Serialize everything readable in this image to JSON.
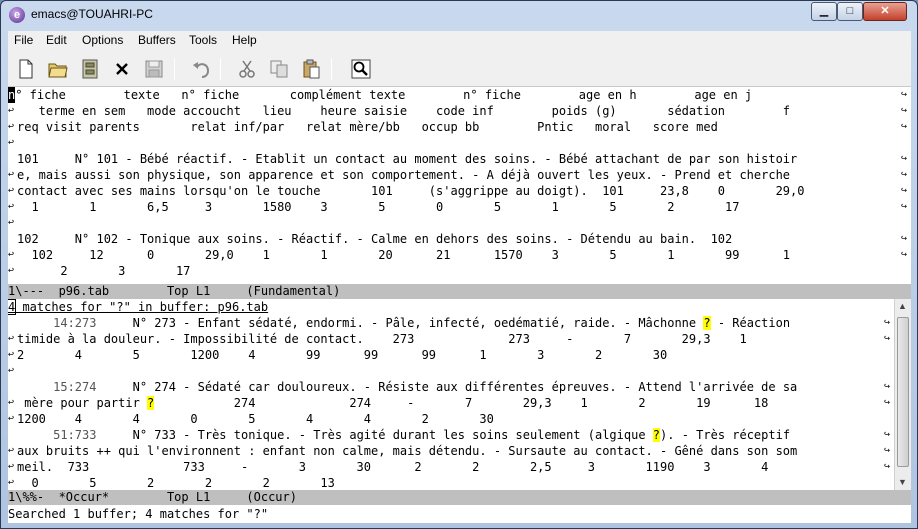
{
  "window": {
    "title": "emacs@TOUAHRI-PC",
    "minimize_glyph": "▁",
    "maximize_glyph": "□",
    "close_glyph": "✕"
  },
  "menu": [
    "File",
    "Edit",
    "Options",
    "Buffers",
    "Tools",
    "Help"
  ],
  "toolbar_icons": [
    "new-file-icon",
    "open-folder-icon",
    "dired-icon",
    "close-buffer-icon",
    "save-icon",
    "undo-icon",
    "cut-icon",
    "copy-icon",
    "paste-icon",
    "search-icon"
  ],
  "colors": {
    "highlight": "#ffff00",
    "modeline": "#bfbfbf",
    "titlebar": "#c9d9ee"
  },
  "top_buffer": {
    "lines": [
      {
        "cursor": "n",
        "text": "° fiche        texte   n° fiche       complément texte        n° fiche        age en h        age en j"
      },
      {
        "text": "   terme en sem   mode accoucht   lieu    heure saisie    code inf        poids (g)       sédation        f"
      },
      {
        "text": "req visit parents       relat inf/par   relat mère/bb   occup bb        Pntic   moral   score med"
      },
      {
        "text": ""
      },
      {
        "text": "101     N° 101 - Bébé réactif. - Etablit un contact au moment des soins. - Bébé attachant de par son histoir"
      },
      {
        "text": "e, mais aussi son physique, son apparence et son comportement. - A déjà ouvert les yeux. - Prend et cherche"
      },
      {
        "text": "contact avec ses mains lorsqu'on le touche       101     (s'aggrippe au doigt).  101     23,8    0       29,0"
      },
      {
        "text": "  1       1       6,5     3       1580    3       5       0       5       1       5       2       17"
      },
      {
        "text": ""
      },
      {
        "text": "102     N° 102 - Tonique aux soins. - Réactif. - Calme en dehors des soins. - Détendu au bain.  102"
      },
      {
        "text": "  102     12      0       29,0    1       1       20      21      1570    3       5       1       99      1"
      },
      {
        "text": "      2       3       17"
      }
    ]
  },
  "top_modeline": "1\\---  p96.tab        Top L1     (Fundamental)",
  "occur": {
    "header_box": "4",
    "header_rest": " matches for \"?\" in buffer: p96.tab",
    "entries": [
      {
        "lnum": "     14:273",
        "lines": [
          {
            "a": "     N° 273 - Enfant sédaté, endormi. - Pâle, infecté, oedématié, raide. - Mâchonne ",
            "m": "?",
            "b": " - Réaction"
          },
          {
            "a": "timide à la douleur. - Impossibilité de contact.    273             273     -       7       29,3    1"
          },
          {
            "a": "2       4       5       1200    4       99      99      99      1       3       2       30"
          },
          {
            "a": ""
          }
        ]
      },
      {
        "lnum": "     15:274",
        "lines": [
          {
            "a": "     N° 274 - Sédaté car douloureux. - Résiste aux différentes épreuves. - Attend l'arrivée de sa"
          },
          {
            "a": " mère pour partir ",
            "m": "?",
            "b": "           274             274     -       7       29,3    1       2       19      18"
          },
          {
            "a": "1200    4       4       0       5       4       4       2       30"
          }
        ]
      },
      {
        "lnum": "     51:733",
        "lines": [
          {
            "a": "     N° 733 - Très tonique. - Très agité durant les soins seulement (algique ",
            "m": "?",
            "b": "). - Très réceptif"
          },
          {
            "a": "aux bruits ++ qui l'environnent : enfant non calme, mais détendu. - Sursaute au contact. - Gêné dans son som"
          },
          {
            "a": "meil.  733             733     -       3       30      2       2       2,5     3       1190    3       4"
          },
          {
            "a": "  0       5       2       2       2       13"
          }
        ]
      }
    ]
  },
  "bottom_modeline": "1\\%%-  *Occur*        Top L1     (Occur)",
  "echo_area": "Searched 1 buffer; 4 matches for \"?\""
}
